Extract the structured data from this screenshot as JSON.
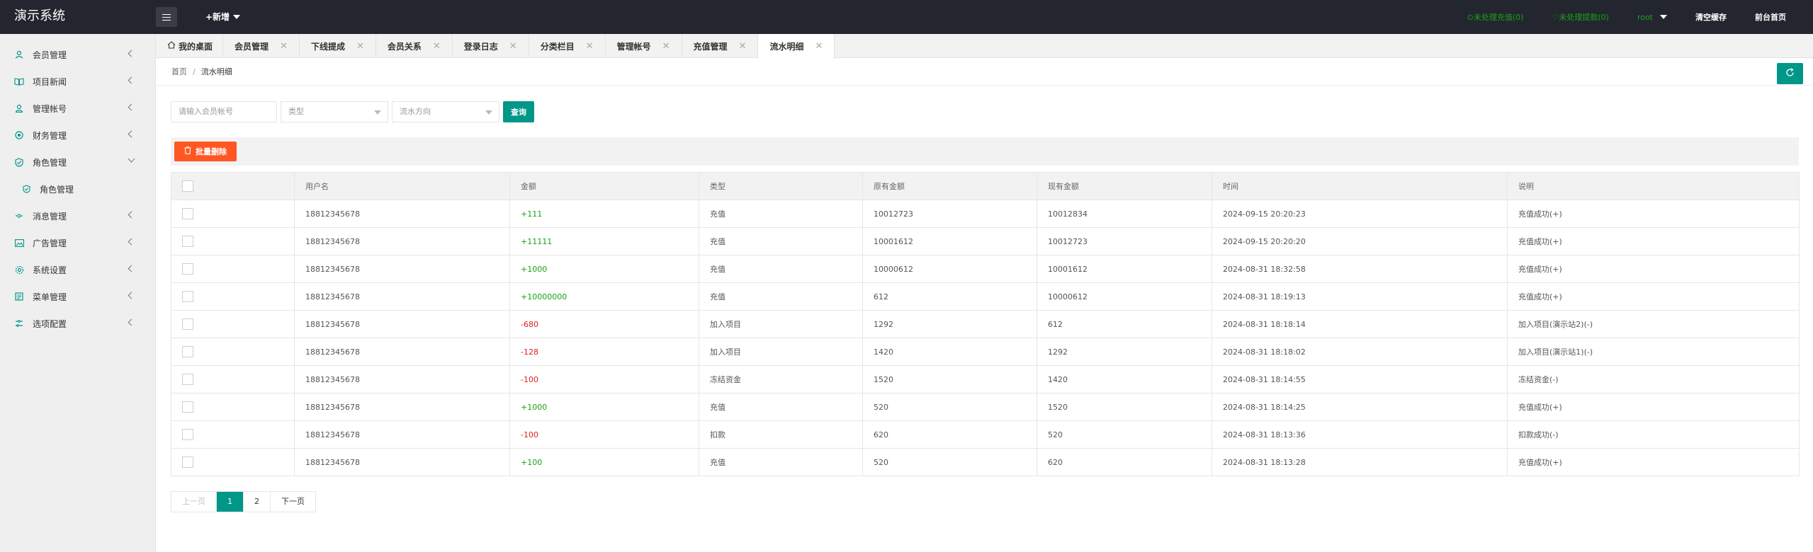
{
  "app": {
    "title": "演示系统"
  },
  "header": {
    "add_label": "+新增",
    "pending_recharge": "⊙未处理充值(0)",
    "pending_withdraw": "♡未处理提款(0)",
    "user": "root",
    "clear_cache": "清空缓存",
    "frontend_home": "前台首页"
  },
  "sidebar": {
    "items": [
      {
        "label": "会员管理",
        "icon": "user-icon"
      },
      {
        "label": "项目新闻",
        "icon": "book-icon"
      },
      {
        "label": "管理帐号",
        "icon": "admin-icon"
      },
      {
        "label": "财务管理",
        "icon": "finance-icon"
      },
      {
        "label": "角色管理",
        "icon": "shield-icon"
      },
      {
        "label": "消息管理",
        "icon": "message-icon"
      },
      {
        "label": "广告管理",
        "icon": "image-icon"
      },
      {
        "label": "系统设置",
        "icon": "gear-icon"
      },
      {
        "label": "菜单管理",
        "icon": "menu-icon"
      },
      {
        "label": "选项配置",
        "icon": "config-icon"
      }
    ],
    "sub_items": [
      {
        "label": "角色管理"
      }
    ]
  },
  "tabs": [
    {
      "label": "我的桌面"
    },
    {
      "label": "会员管理"
    },
    {
      "label": "下线提成"
    },
    {
      "label": "会员关系"
    },
    {
      "label": "登录日志"
    },
    {
      "label": "分类栏目"
    },
    {
      "label": "管理帐号"
    },
    {
      "label": "充值管理"
    },
    {
      "label": "流水明细"
    }
  ],
  "breadcrumb": {
    "home": "首页",
    "sep": "/",
    "current": "流水明细"
  },
  "filters": {
    "account_placeholder": "请输入会员帐号",
    "type_placeholder": "类型",
    "direction_placeholder": "流水方向",
    "query_label": "查询"
  },
  "toolbar": {
    "batch_delete_label": "批量删除"
  },
  "table": {
    "headers": [
      "用户名",
      "金额",
      "类型",
      "原有金额",
      "现有金额",
      "时间",
      "说明"
    ],
    "rows": [
      {
        "user": "18812345678",
        "amount": "+111",
        "type": "充值",
        "before": "10012723",
        "after": "10012834",
        "time": "2024-09-15 20:20:23",
        "note": "充值成功(+)"
      },
      {
        "user": "18812345678",
        "amount": "+11111",
        "type": "充值",
        "before": "10001612",
        "after": "10012723",
        "time": "2024-09-15 20:20:20",
        "note": "充值成功(+)"
      },
      {
        "user": "18812345678",
        "amount": "+1000",
        "type": "充值",
        "before": "10000612",
        "after": "10001612",
        "time": "2024-08-31 18:32:58",
        "note": "充值成功(+)"
      },
      {
        "user": "18812345678",
        "amount": "+10000000",
        "type": "充值",
        "before": "612",
        "after": "10000612",
        "time": "2024-08-31 18:19:13",
        "note": "充值成功(+)"
      },
      {
        "user": "18812345678",
        "amount": "-680",
        "type": "加入项目",
        "before": "1292",
        "after": "612",
        "time": "2024-08-31 18:18:14",
        "note": "加入项目(演示站2)(-)"
      },
      {
        "user": "18812345678",
        "amount": "-128",
        "type": "加入项目",
        "before": "1420",
        "after": "1292",
        "time": "2024-08-31 18:18:02",
        "note": "加入项目(演示站1)(-)"
      },
      {
        "user": "18812345678",
        "amount": "-100",
        "type": "冻结资金",
        "before": "1520",
        "after": "1420",
        "time": "2024-08-31 18:14:55",
        "note": "冻结资金(-)"
      },
      {
        "user": "18812345678",
        "amount": "+1000",
        "type": "充值",
        "before": "520",
        "after": "1520",
        "time": "2024-08-31 18:14:25",
        "note": "充值成功(+)"
      },
      {
        "user": "18812345678",
        "amount": "-100",
        "type": "扣款",
        "before": "620",
        "after": "520",
        "time": "2024-08-31 18:13:36",
        "note": "扣款成功(-)"
      },
      {
        "user": "18812345678",
        "amount": "+100",
        "type": "充值",
        "before": "520",
        "after": "620",
        "time": "2024-08-31 18:13:28",
        "note": "充值成功(+)"
      }
    ]
  },
  "pager": {
    "prev": "上一页",
    "pages": [
      "1",
      "2"
    ],
    "next": "下一页"
  },
  "colors": {
    "accent": "#009688",
    "danger": "#ff5722",
    "header_bg": "#23262e",
    "positive": "#1aa01a",
    "negative": "#e02020"
  }
}
